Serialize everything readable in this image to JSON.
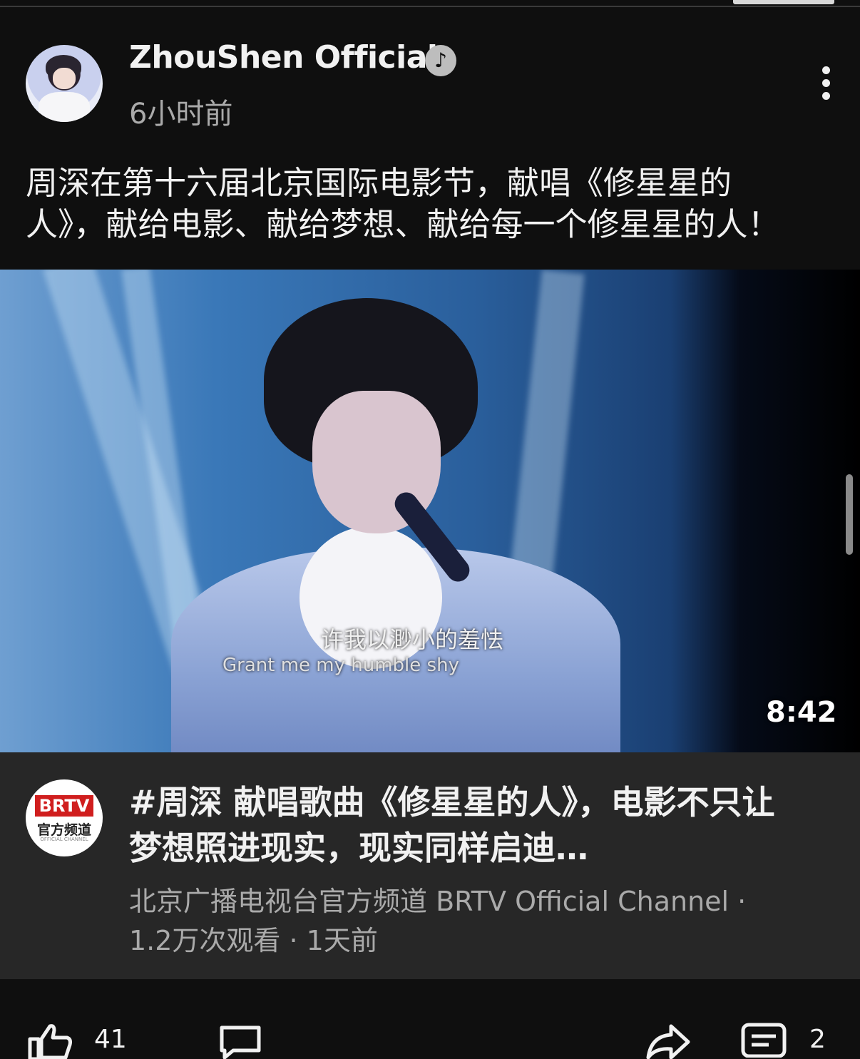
{
  "post": {
    "channel_name": "ZhouShen Official",
    "time": "6小时前",
    "text": "周深在第十六届北京国际电影节，献唱《修星星的\n人》，献给电影、献给梦想、献给每一个修星星的人！"
  },
  "video": {
    "subtitle_cn": "许我以渺小的羞怯",
    "subtitle_en": "Grant me my humble shy",
    "duration": "8:42"
  },
  "linked_video": {
    "logo_text": "BRTV",
    "logo_subtext": "官方频道",
    "logo_small": "OFFICIAL CHANNEL",
    "title": "#周深 献唱歌曲《修星星的人》，电影不只让梦想照进现实，现实同样启迪…",
    "channel": "北京广播电视台官方频道 BRTV Official Channel ·",
    "meta": "1.2万次观看 · 1天前"
  },
  "actions": {
    "like_count": "41",
    "comment_count": "2"
  },
  "colors": {
    "background": "#0f0f0f",
    "card_background": "#272727",
    "secondary_text": "#aaaaaa",
    "brtv_red": "#d01e1e"
  },
  "icons": [
    "verified-icon",
    "more-vert-icon",
    "like-icon",
    "comment-icon",
    "share-icon",
    "save-icon"
  ]
}
